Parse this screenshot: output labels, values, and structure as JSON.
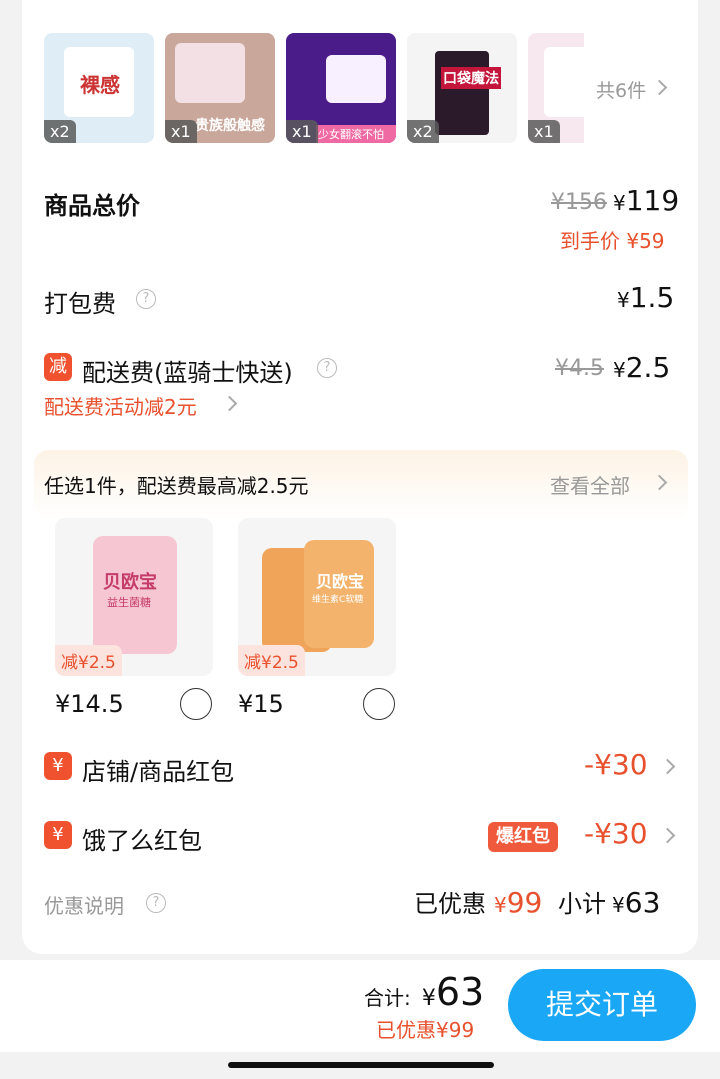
{
  "items": {
    "thumbnails": [
      {
        "qty": "x2",
        "color": "#dfeef6",
        "art_text": "裸感"
      },
      {
        "qty": "x1",
        "color": "#c9a79b",
        "art_text": "贵族般触感"
      },
      {
        "qty": "x1",
        "color": "#4a1c8a",
        "art_text": "少女翻滚不怕漏"
      },
      {
        "qty": "x2",
        "color": "#f4f4f4",
        "art_text": "口袋魔法"
      },
      {
        "qty": "x1",
        "color": "#f7e8ef",
        "art_text": ""
      }
    ],
    "total_count": "共6件"
  },
  "goods_total": {
    "label": "商品总价",
    "original": "¥156",
    "price_symbol": "¥",
    "price": "119",
    "final_label": "到手价 ¥59"
  },
  "packing_fee": {
    "label": "打包费",
    "price_symbol": "¥",
    "price": "1.5"
  },
  "delivery": {
    "badge": "减",
    "label": "配送费(蓝骑士快送)",
    "original": "¥4.5",
    "price_symbol": "¥",
    "price": "2.5",
    "note": "配送费活动减2元"
  },
  "promo": {
    "title": "任选1件，配送费最高减2.5元",
    "view_all": "查看全部",
    "products": [
      {
        "tag": "减¥2.5",
        "price": "¥14.5",
        "brand": "贝欧宝",
        "sub": "益生菌糖",
        "color": "#f6c7d2"
      },
      {
        "tag": "减¥2.5",
        "price": "¥15",
        "brand": "贝欧宝",
        "sub": "维生素C软糖",
        "color": "#f0a45a"
      }
    ]
  },
  "coupons": [
    {
      "icon": "¥",
      "label": "店铺/商品红包",
      "value": "-¥30",
      "hot": ""
    },
    {
      "icon": "¥",
      "label": "饿了么红包",
      "value": "-¥30",
      "hot": "爆红包"
    }
  ],
  "summary": {
    "label": "优惠说明",
    "saved_label": "已优惠",
    "saved_symbol": "¥",
    "saved_value": "99",
    "subtotal_label": "小计",
    "subtotal_symbol": "¥",
    "subtotal_value": "63"
  },
  "footer": {
    "total_label": "合计:",
    "total_symbol": "¥",
    "total_value": "63",
    "saved": "已优惠¥99",
    "submit": "提交订单"
  },
  "colors": {
    "accent": "#1aa7f5",
    "red": "#e8512e"
  }
}
